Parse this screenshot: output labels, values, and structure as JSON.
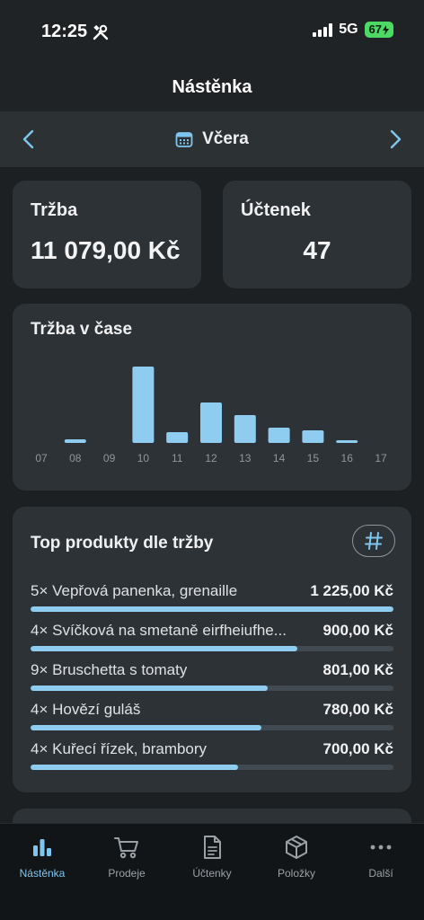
{
  "status": {
    "time": "12:25",
    "network": "5G",
    "battery": "67"
  },
  "header": {
    "title": "Nástěnka"
  },
  "date_nav": {
    "label": "Včera"
  },
  "stats": {
    "revenue_label": "Tržba",
    "revenue_value": "11 079,00 Kč",
    "receipts_label": "Účtenek",
    "receipts_value": "47"
  },
  "chart_data": {
    "type": "bar",
    "title": "Tržba v čase",
    "categories": [
      "07",
      "08",
      "09",
      "10",
      "11",
      "12",
      "13",
      "14",
      "15",
      "16",
      "17"
    ],
    "values": [
      0,
      4,
      0,
      85,
      12,
      45,
      31,
      17,
      14,
      3,
      0
    ],
    "ylim": [
      0,
      85
    ],
    "color": "#8ecdf0",
    "grid": false
  },
  "top_products": {
    "title": "Top produkty dle tržby",
    "items": [
      {
        "name": "5× Vepřová panenka, grenaille",
        "value": "1 225,00 Kč",
        "share": 1.0
      },
      {
        "name": "4× Svíčková na smetaně eirfheiufhe...",
        "value": "900,00 Kč",
        "share": 0.735
      },
      {
        "name": "9× Bruschetta s tomaty",
        "value": "801,00 Kč",
        "share": 0.654
      },
      {
        "name": "4× Hovězí guláš",
        "value": "780,00 Kč",
        "share": 0.637
      },
      {
        "name": "4× Kuřecí řízek, brambory",
        "value": "700,00 Kč",
        "share": 0.571
      }
    ]
  },
  "tabs": [
    {
      "label": "Nástěnka",
      "icon": "bar-chart-icon",
      "active": true
    },
    {
      "label": "Prodeje",
      "icon": "cart-icon",
      "active": false
    },
    {
      "label": "Účtenky",
      "icon": "receipt-icon",
      "active": false
    },
    {
      "label": "Položky",
      "icon": "box-icon",
      "active": false
    },
    {
      "label": "Další",
      "icon": "more-icon",
      "active": false
    }
  ],
  "colors": {
    "accent": "#7fc6ee",
    "bar": "#8ecdf0",
    "card": "#2d3236",
    "background": "#1c2022"
  }
}
